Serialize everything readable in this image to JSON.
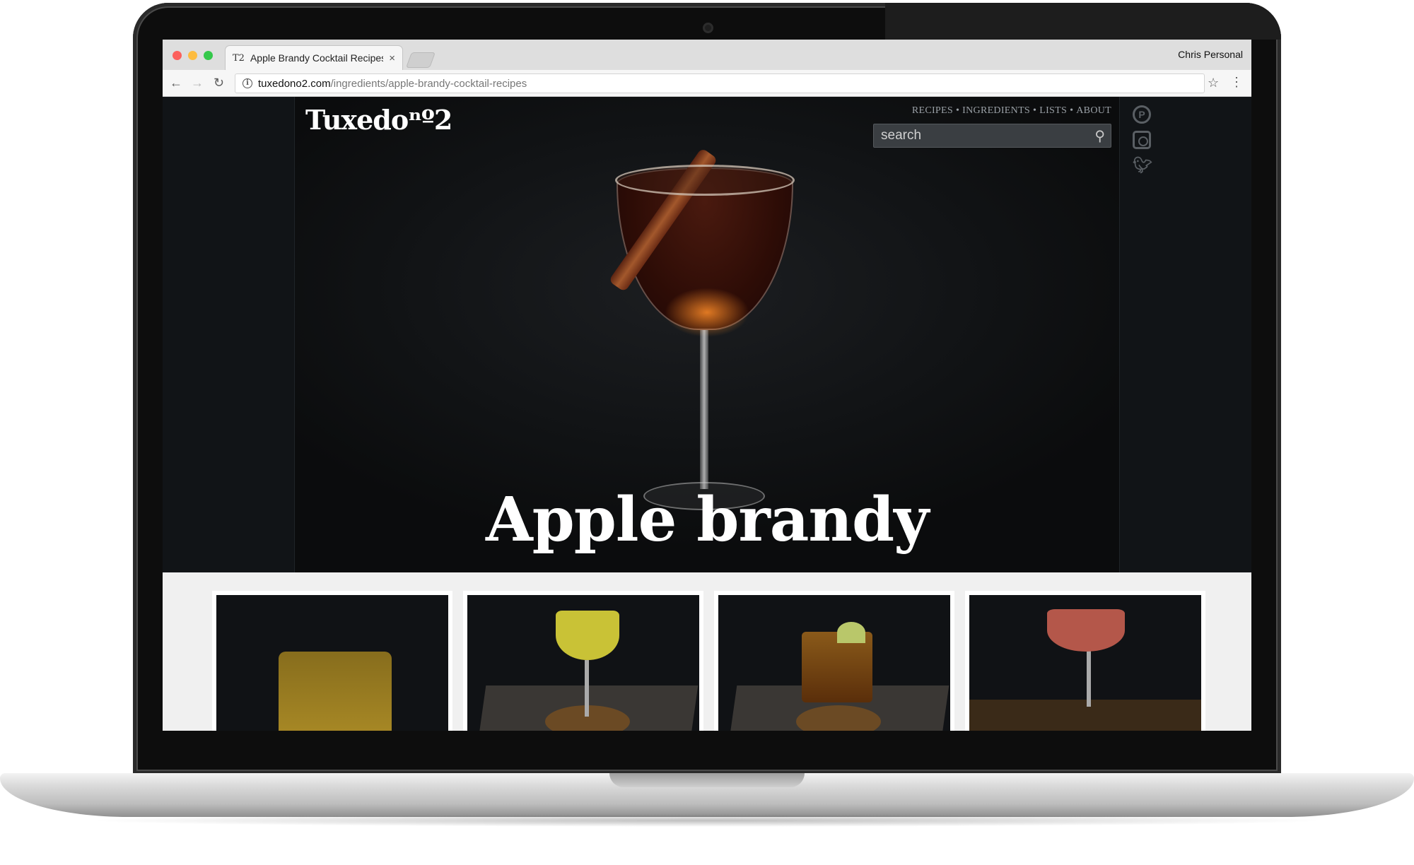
{
  "browser": {
    "tab_title": "Apple Brandy Cocktail Recipes",
    "tab_favicon": "T2",
    "profile_name": "Chris Personal",
    "url_domain": "tuxedono2.com",
    "url_path": "/ingredients/apple-brandy-cocktail-recipes"
  },
  "site": {
    "logo": "Tuxedoⁿº2",
    "nav": [
      "RECIPES",
      "INGREDIENTS",
      "LISTS",
      "ABOUT"
    ],
    "nav_separator": "•",
    "search_placeholder": "search",
    "social_icons": [
      "pinterest-icon",
      "instagram-icon",
      "twitter-icon"
    ]
  },
  "hero": {
    "title": "Apple brandy"
  },
  "recipes": [
    {
      "image": "yellow-rocks-cocktail"
    },
    {
      "image": "yellow-coupe-cocktail"
    },
    {
      "image": "old-fashioned-with-lime"
    },
    {
      "image": "pink-coupe-cocktail"
    }
  ],
  "colors": {
    "page_bg": "#111417",
    "grid_bg": "#f0f0f0",
    "search_bg": "#3a3e42",
    "nav_text": "#9aa0a6"
  }
}
